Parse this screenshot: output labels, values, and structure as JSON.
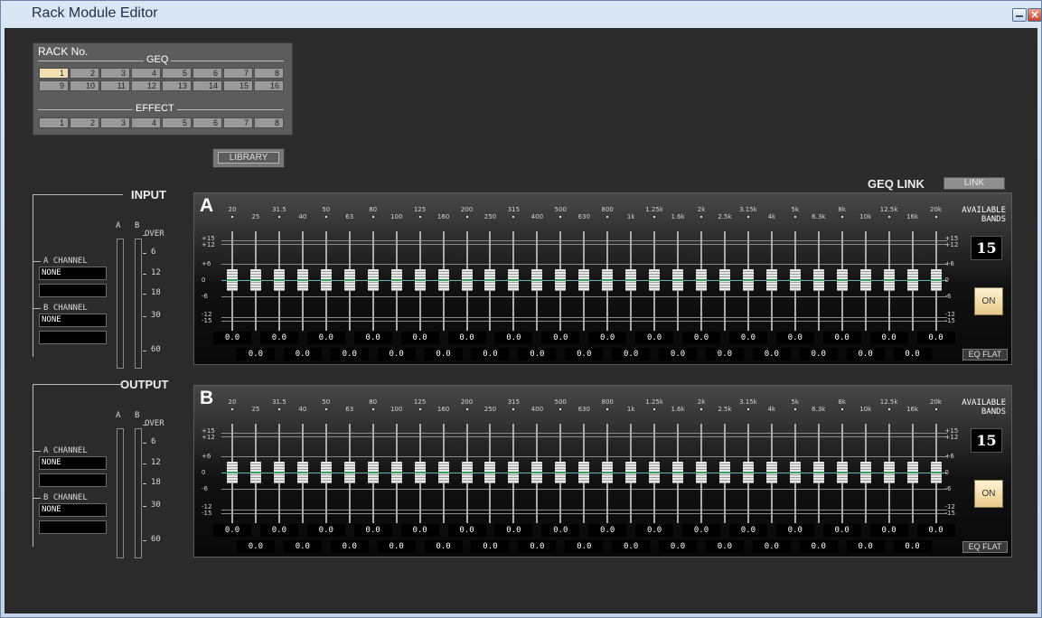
{
  "window": {
    "title": "Rack Module Editor"
  },
  "rack": {
    "title": "RACK No.",
    "geq_label": "GEQ",
    "geq_row1": [
      "1",
      "2",
      "3",
      "4",
      "5",
      "6",
      "7",
      "8"
    ],
    "geq_row2": [
      "9",
      "10",
      "11",
      "12",
      "13",
      "14",
      "15",
      "16"
    ],
    "effect_label": "EFFECT",
    "effect_row": [
      "1",
      "2",
      "3",
      "4",
      "5",
      "6",
      "7",
      "8"
    ],
    "selected": "1"
  },
  "library_label": "LIBRARY",
  "geq_link": {
    "label": "GEQ LINK",
    "button": "LINK"
  },
  "input": {
    "title": "INPUT",
    "meter_heads": [
      "A",
      "B"
    ],
    "meter_scale": [
      "OVER",
      "6",
      "12",
      "18",
      "30",
      "60"
    ],
    "a_channel_label": "A CHANNEL",
    "a_channel_value": "NONE",
    "b_channel_label": "B CHANNEL",
    "b_channel_value": "NONE"
  },
  "output": {
    "title": "OUTPUT",
    "meter_heads": [
      "A",
      "B"
    ],
    "meter_scale": [
      "OVER",
      "6",
      "12",
      "18",
      "30",
      "60"
    ],
    "a_channel_label": "A CHANNEL",
    "a_channel_value": "NONE",
    "b_channel_label": "B CHANNEL",
    "b_channel_value": "NONE"
  },
  "eq_panels": [
    {
      "id": "A",
      "available_label": "AVAILABLE BANDS",
      "bands": "15",
      "on_label": "ON",
      "eqflat_label": "EQ FLAT"
    },
    {
      "id": "B",
      "available_label": "AVAILABLE BANDS",
      "bands": "15",
      "on_label": "ON",
      "eqflat_label": "EQ FLAT"
    }
  ],
  "frequencies": [
    "20",
    "25",
    "31.5",
    "40",
    "50",
    "63",
    "80",
    "100",
    "125",
    "160",
    "200",
    "250",
    "315",
    "400",
    "500",
    "630",
    "800",
    "1k",
    "1.25k",
    "1.6k",
    "2k",
    "2.5k",
    "3.15k",
    "4k",
    "5k",
    "6.3k",
    "8k",
    "10k",
    "12.5k",
    "16k",
    "20k"
  ],
  "db_scale": {
    "top": "+15\n+12",
    "plus6": "+6",
    "zero": "0",
    "minus6": "-6",
    "bottom": "-12\n-15"
  },
  "gains": [
    "0.0",
    "0.0",
    "0.0",
    "0.0",
    "0.0",
    "0.0",
    "0.0",
    "0.0",
    "0.0",
    "0.0",
    "0.0",
    "0.0",
    "0.0",
    "0.0",
    "0.0",
    "0.0",
    "0.0",
    "0.0",
    "0.0",
    "0.0",
    "0.0",
    "0.0",
    "0.0",
    "0.0",
    "0.0",
    "0.0",
    "0.0",
    "0.0",
    "0.0",
    "0.0",
    "0.0"
  ]
}
